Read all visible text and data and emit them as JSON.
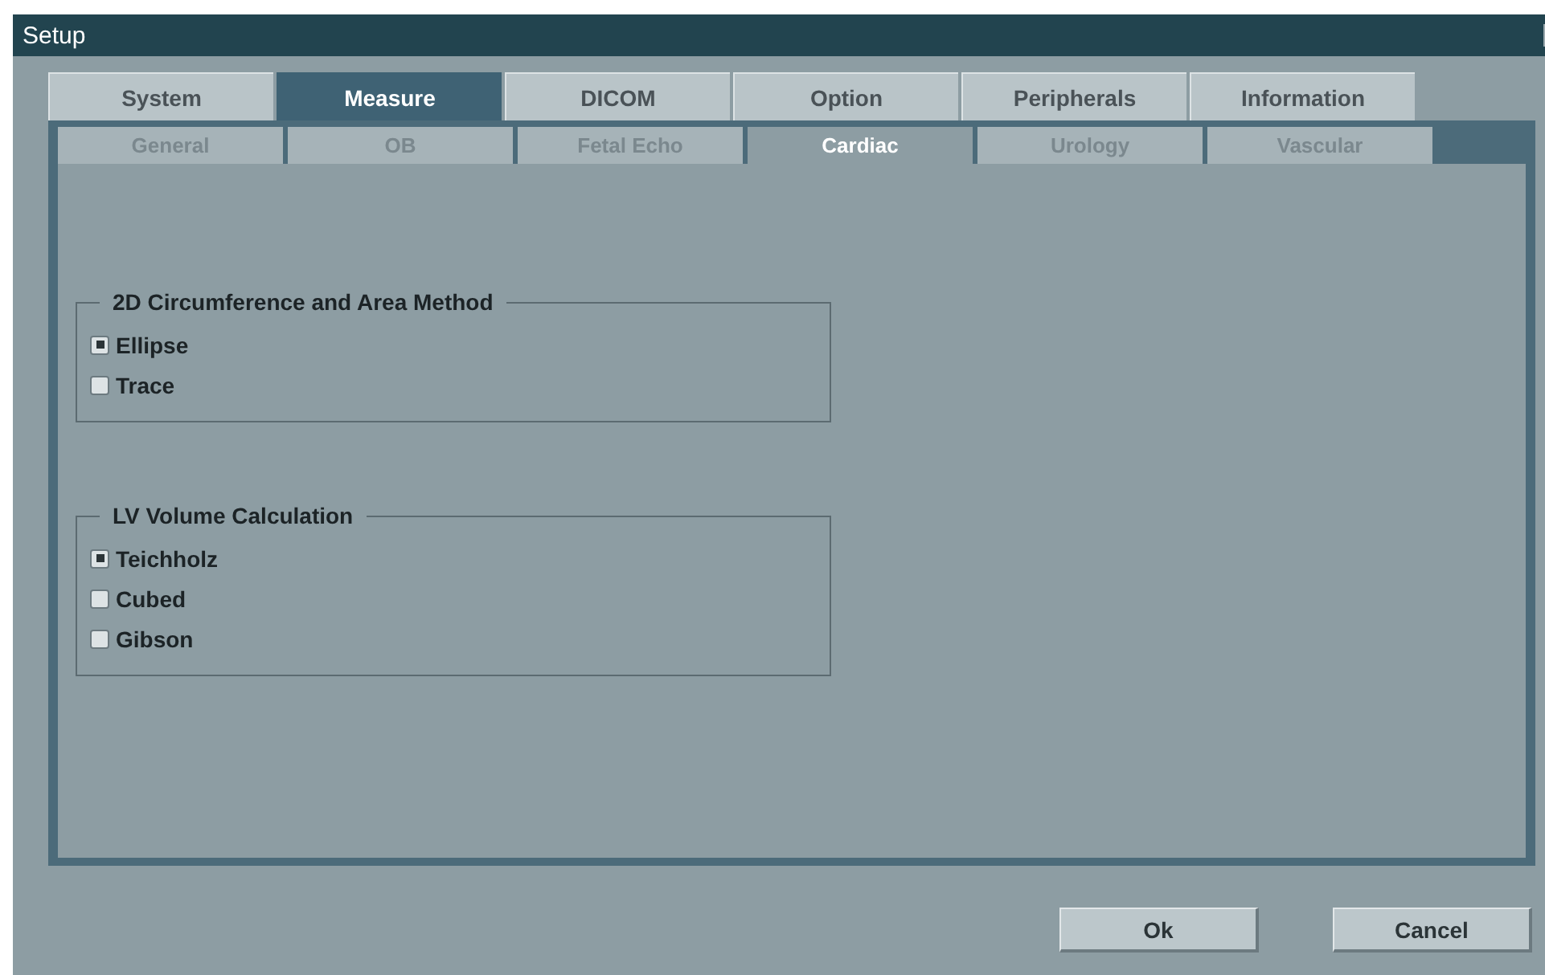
{
  "window": {
    "title": "Setup"
  },
  "tabs": [
    {
      "label": "System",
      "selected": false
    },
    {
      "label": "Measure",
      "selected": true
    },
    {
      "label": "DICOM",
      "selected": false
    },
    {
      "label": "Option",
      "selected": false
    },
    {
      "label": "Peripherals",
      "selected": false
    },
    {
      "label": "Information",
      "selected": false
    }
  ],
  "subtabs": [
    {
      "label": "General",
      "selected": false
    },
    {
      "label": "OB",
      "selected": false
    },
    {
      "label": "Fetal Echo",
      "selected": false
    },
    {
      "label": "Cardiac",
      "selected": true
    },
    {
      "label": "Urology",
      "selected": false
    },
    {
      "label": "Vascular",
      "selected": false
    }
  ],
  "groups": [
    {
      "title": "2D Circumference and Area Method",
      "options": [
        {
          "label": "Ellipse",
          "selected": true
        },
        {
          "label": "Trace",
          "selected": false
        }
      ]
    },
    {
      "title": "LV Volume Calculation",
      "options": [
        {
          "label": "Teichholz",
          "selected": true
        },
        {
          "label": "Cubed",
          "selected": false
        },
        {
          "label": "Gibson",
          "selected": false
        }
      ]
    }
  ],
  "buttons": [
    "Ok",
    "Cancel"
  ]
}
